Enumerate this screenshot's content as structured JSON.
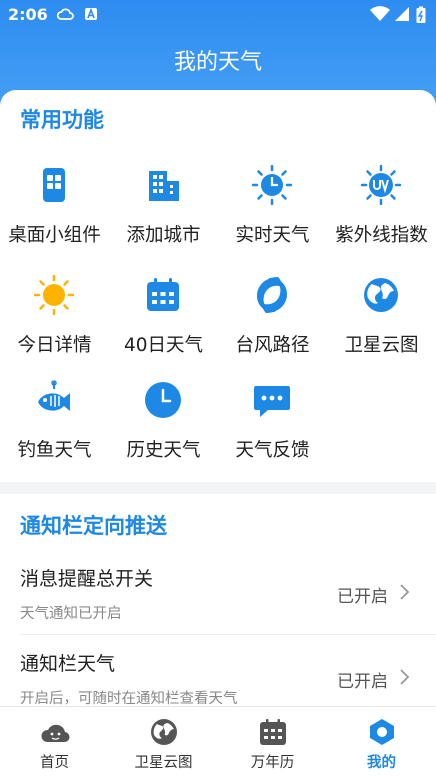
{
  "status_bar": {
    "time": "2:06"
  },
  "header": {
    "title": "我的天气"
  },
  "common": {
    "title": "常用功能",
    "items": [
      {
        "label": "桌面小组件",
        "icon": "widget-icon"
      },
      {
        "label": "添加城市",
        "icon": "building-icon"
      },
      {
        "label": "实时天气",
        "icon": "sun-clock-icon"
      },
      {
        "label": "紫外线指数",
        "icon": "uv-icon"
      },
      {
        "label": "今日详情",
        "icon": "sun-icon"
      },
      {
        "label": "40日天气",
        "icon": "calendar-icon"
      },
      {
        "label": "台风路径",
        "icon": "typhoon-icon"
      },
      {
        "label": "卫星云图",
        "icon": "globe-icon"
      },
      {
        "label": "钓鱼天气",
        "icon": "fish-icon"
      },
      {
        "label": "历史天气",
        "icon": "clock-icon"
      },
      {
        "label": "天气反馈",
        "icon": "feedback-icon"
      }
    ]
  },
  "notify": {
    "title": "通知栏定向推送",
    "rows": [
      {
        "title": "消息提醒总开关",
        "subtitle": "天气通知已开启",
        "status": "已开启"
      },
      {
        "title": "通知栏天气",
        "subtitle": "开启后，可随时在通知栏查看天气",
        "status": "已开启"
      }
    ]
  },
  "tabs": [
    {
      "label": "首页",
      "icon": "cloud-face-icon"
    },
    {
      "label": "卫星云图",
      "icon": "globe-icon"
    },
    {
      "label": "万年历",
      "icon": "calendar-icon"
    },
    {
      "label": "我的",
      "icon": "hexagon-icon"
    }
  ],
  "colors": {
    "accent": "#1e88e5",
    "header": "#2d8cf0",
    "sun": "#ffb300"
  }
}
